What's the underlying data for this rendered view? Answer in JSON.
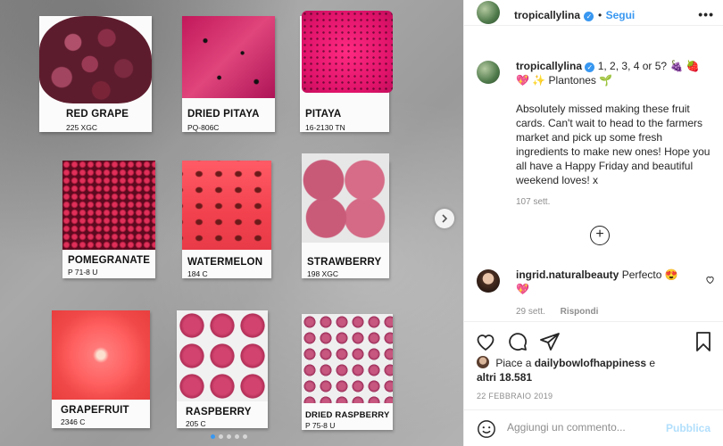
{
  "post": {
    "cards": [
      {
        "name": "RED GRAPE",
        "code": "225 XGC"
      },
      {
        "name": "DRIED PITAYA",
        "code": "PQ-806C"
      },
      {
        "name": "PITAYA",
        "code": "16-2130 TN"
      },
      {
        "name": "POMEGRANATE",
        "code": "P 71-8 U"
      },
      {
        "name": "WATERMELON",
        "code": "184 C"
      },
      {
        "name": "STRAWBERRY",
        "code": "198 XGC"
      },
      {
        "name": "GRAPEFRUIT",
        "code": "2346 C"
      },
      {
        "name": "RASPBERRY",
        "code": "205 C"
      },
      {
        "name": "DRIED RASPBERRY",
        "code": "P 75-8 U"
      }
    ],
    "carousel_total": 5,
    "carousel_active": 1
  },
  "header": {
    "username": "tropicallylina",
    "separator": "•",
    "follow_label": "Segui",
    "more_label": "•••"
  },
  "caption": {
    "username": "tropicallylina",
    "title_text": "1, 2, 3, 4 or 5? 🍇 🍓",
    "title_text_2": "💖 ✨ Plantones 🌱",
    "body": "Absolutely missed making these fruit cards. Can't wait to head to the farmers market and pick up some fresh ingredients to make new ones! Hope you all have a Happy Friday and beautiful weekend loves! x",
    "time": "107 sett."
  },
  "comment": {
    "username": "ingrid.naturalbeauty",
    "text": "Perfecto 😍",
    "text_2": "💖",
    "time": "29 sett.",
    "reply_label": "Rispondi"
  },
  "likes": {
    "prefix": "Piace a",
    "user": "dailybowlofhappiness",
    "connector": "e",
    "others": "altri 18.581"
  },
  "date": "22 FEBBRAIO 2019",
  "comment_box": {
    "placeholder": "Aggiungi un commento...",
    "publish_label": "Pubblica"
  },
  "colors": {
    "accent": "#3897f0",
    "publish_disabled": "#b2dffc",
    "text": "#262626",
    "muted": "#8e8e8e"
  }
}
